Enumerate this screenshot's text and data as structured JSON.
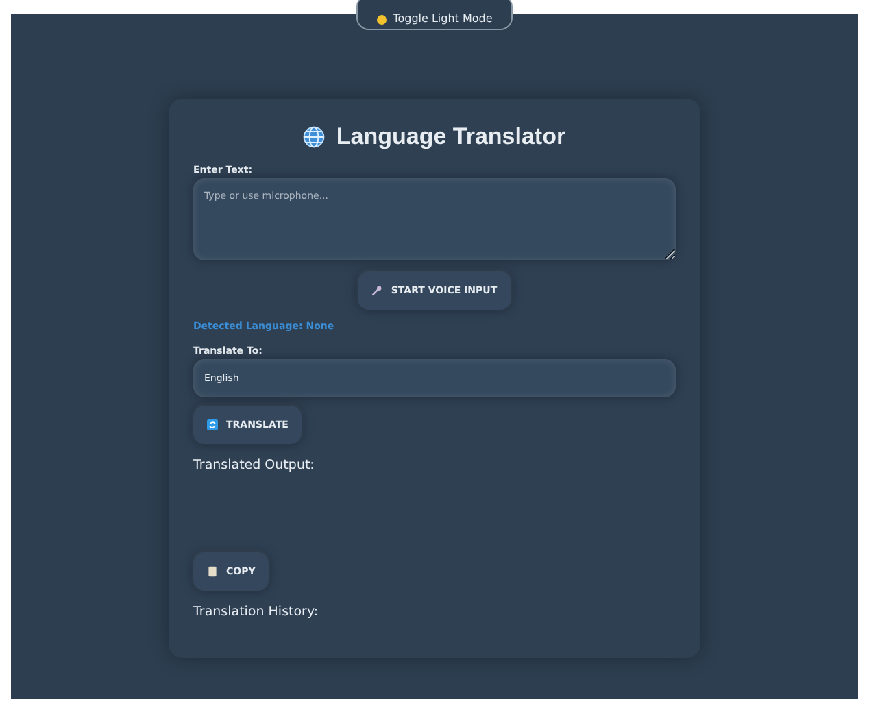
{
  "theme_toggle": {
    "label": "Toggle Light Mode"
  },
  "title": "Language Translator",
  "input": {
    "label": "Enter Text:",
    "placeholder": "Type or use microphone..."
  },
  "voice_button": "START VOICE INPUT",
  "detected_language": "Detected Language: None",
  "target": {
    "label": "Translate To:",
    "value": "English"
  },
  "translate_button": "TRANSLATE",
  "output_heading": "Translated Output:",
  "copy_button": "COPY",
  "history_heading": "Translation History:"
}
